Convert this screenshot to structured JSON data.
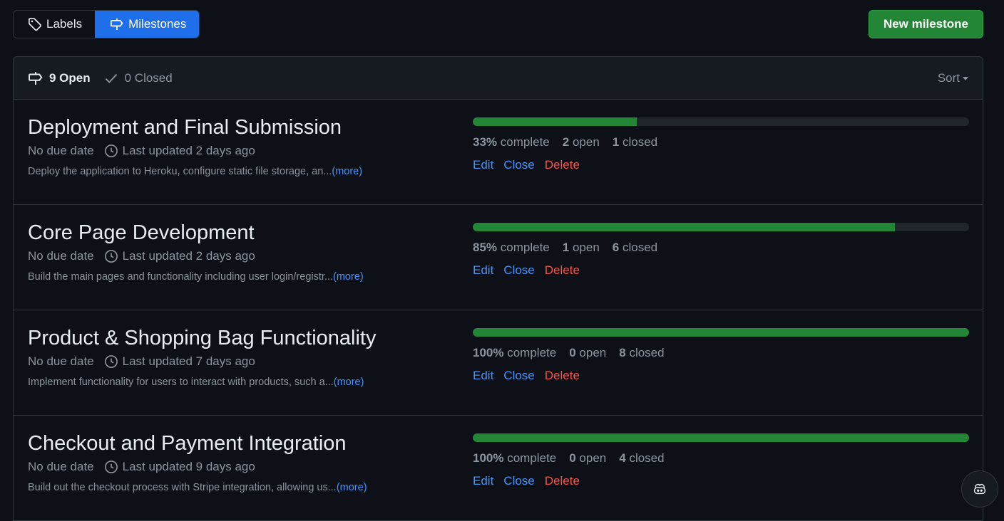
{
  "tabs": {
    "labels": "Labels",
    "milestones": "Milestones"
  },
  "new_milestone": "New milestone",
  "header": {
    "open_count": "9 Open",
    "closed_count": "0 Closed",
    "sort": "Sort"
  },
  "colors": {
    "accent": "#1f6feb",
    "success": "#238636",
    "danger": "#f85149",
    "link": "#4493f8"
  },
  "milestones": [
    {
      "title": "Deployment and Final Submission",
      "due": "No due date",
      "updated": "Last updated 2 days ago",
      "description": "Deploy the application to Heroku, configure static file storage, an...",
      "more": "(more)",
      "percent": "33%",
      "percent_value": 33,
      "complete_label": "complete",
      "open_num": "2",
      "open_label": "open",
      "closed_num": "1",
      "closed_label": "closed"
    },
    {
      "title": "Core Page Development",
      "due": "No due date",
      "updated": "Last updated 2 days ago",
      "description": "Build the main pages and functionality including user login/registr...",
      "more": "(more)",
      "percent": "85%",
      "percent_value": 85,
      "complete_label": "complete",
      "open_num": "1",
      "open_label": "open",
      "closed_num": "6",
      "closed_label": "closed"
    },
    {
      "title": "Product & Shopping Bag Functionality",
      "due": "No due date",
      "updated": "Last updated 7 days ago",
      "description": "Implement functionality for users to interact with products, such a...",
      "more": "(more)",
      "percent": "100%",
      "percent_value": 100,
      "complete_label": "complete",
      "open_num": "0",
      "open_label": "open",
      "closed_num": "8",
      "closed_label": "closed"
    },
    {
      "title": "Checkout and Payment Integration",
      "due": "No due date",
      "updated": "Last updated 9 days ago",
      "description": "Build out the checkout process with Stripe integration, allowing us...",
      "more": "(more)",
      "percent": "100%",
      "percent_value": 100,
      "complete_label": "complete",
      "open_num": "0",
      "open_label": "open",
      "closed_num": "4",
      "closed_label": "closed"
    }
  ],
  "actions": {
    "edit": "Edit",
    "close": "Close",
    "delete": "Delete"
  },
  "icons": {
    "labels_tab": "tag-icon",
    "milestones_tab": "milestone-icon",
    "open": "milestone-icon",
    "closed": "check-icon",
    "clock": "clock-icon",
    "copilot": "copilot-icon"
  }
}
